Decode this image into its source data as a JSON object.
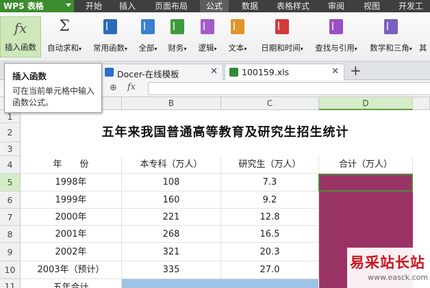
{
  "menubar": {
    "app_label": "WPS 表格",
    "items": [
      "开始",
      "插入",
      "页面布局",
      "公式",
      "数据",
      "表格样式",
      "审阅",
      "视图",
      "开发工"
    ],
    "active_index": 3
  },
  "ribbon": {
    "buttons": [
      {
        "label": "插入函数",
        "icon": "fx-icon"
      },
      {
        "label": "自动求和",
        "icon": "sigma-icon"
      },
      {
        "label": "常用函数",
        "icon": "book-icon"
      },
      {
        "label": "全部",
        "icon": "book-icon"
      },
      {
        "label": "财务",
        "icon": "book-icon"
      },
      {
        "label": "逻辑",
        "icon": "book-icon"
      },
      {
        "label": "文本",
        "icon": "book-icon"
      },
      {
        "label": "日期和时间",
        "icon": "clock-icon"
      },
      {
        "label": "查找与引用",
        "icon": "search-book-icon"
      },
      {
        "label": "数学和三角",
        "icon": "theta-book-icon"
      },
      {
        "label": "其",
        "icon": ""
      }
    ]
  },
  "tabs": [
    {
      "title": "Docer-在线模板"
    },
    {
      "title": "100159.xls"
    }
  ],
  "tooltip": {
    "title": "插入函数",
    "body": "可在当前单元格中输入函数公式。"
  },
  "formula_bar": {
    "fx": "fx",
    "value": ""
  },
  "sheet": {
    "columns": [
      "B",
      "C",
      "D"
    ],
    "rows": [
      "1",
      "2",
      "3",
      "4",
      "5",
      "6",
      "7",
      "8",
      "9",
      "10",
      "11"
    ],
    "title": "五年来我国普通高等教育及研究生招生统计",
    "header": {
      "year": "年　　份",
      "undergrad": "本专科（万人）",
      "grad": "研究生（万人）",
      "total": "合计（万人）"
    },
    "data": [
      {
        "year": "1998年",
        "undergrad": "108",
        "grad": "7.3"
      },
      {
        "year": "1999年",
        "undergrad": "160",
        "grad": "9.2"
      },
      {
        "year": "2000年",
        "undergrad": "221",
        "grad": "12.8"
      },
      {
        "year": "2001年",
        "undergrad": "268",
        "grad": "16.5"
      },
      {
        "year": "2002年",
        "undergrad": "321",
        "grad": "20.3"
      },
      {
        "year": "2003年（预计）",
        "undergrad": "335",
        "grad": "27.0"
      }
    ],
    "row11_label": "五年合计"
  },
  "watermark": {
    "text": "易采站长站",
    "url": "www.easck.com"
  },
  "colors": {
    "accent": "#3c8b2c",
    "selection_fill": "#993366",
    "blue_fill": "#9dc3e6"
  }
}
